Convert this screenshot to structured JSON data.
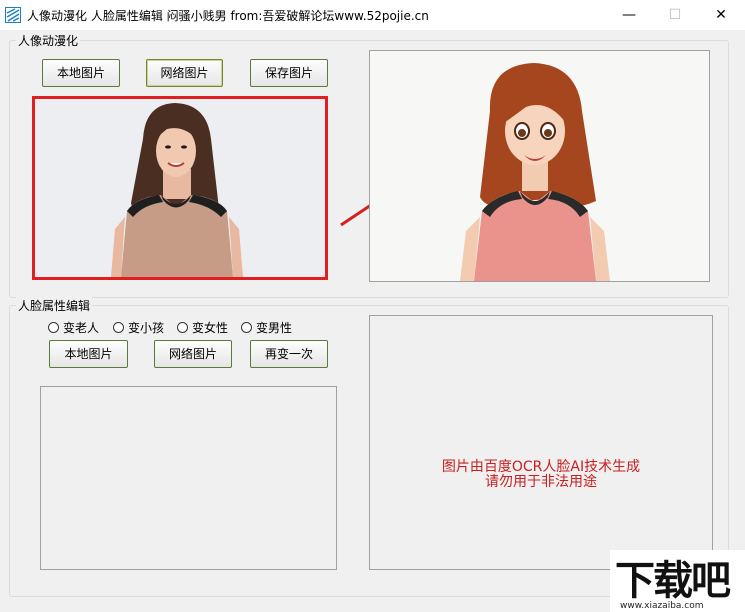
{
  "window": {
    "title": "人像动漫化 人脸属性编辑 闷骚小贱男 from:吾爱破解论坛www.52pojie.cn",
    "minimize": "—",
    "maximize": "☐",
    "close": "✕"
  },
  "anime": {
    "legend": "人像动漫化",
    "local_btn": "本地图片",
    "net_btn": "网络图片",
    "save_btn": "保存图片"
  },
  "face": {
    "legend": "人脸属性编辑",
    "options": [
      "变老人",
      "变小孩",
      "变女性",
      "变男性"
    ],
    "local_btn": "本地图片",
    "net_btn": "网络图片",
    "again_btn": "再变一次",
    "note_line1": "图片由百度OCR人脸AI技术生成",
    "note_line2": "请勿用于非法用途"
  },
  "watermark": {
    "text": "下载吧",
    "url": "www.xiazaiba.com"
  },
  "colors": {
    "highlight_border": "#e02020",
    "arrow": "#d42020",
    "note": "#c82020"
  }
}
